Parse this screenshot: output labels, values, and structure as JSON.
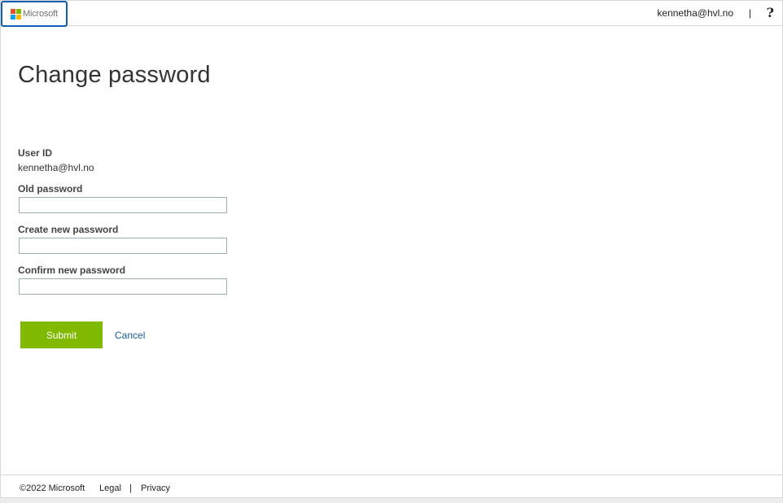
{
  "header": {
    "logo_text": "Microsoft",
    "user_email": "kennetha@hvl.no",
    "separator": "|",
    "help_glyph": "?"
  },
  "main": {
    "title": "Change password",
    "user_id_label": "User ID",
    "user_id_value": "kennetha@hvl.no",
    "old_password_label": "Old password",
    "old_password_value": "",
    "new_password_label": "Create new password",
    "new_password_value": "",
    "confirm_password_label": "Confirm new password",
    "confirm_password_value": "",
    "submit_label": "Submit",
    "cancel_label": "Cancel"
  },
  "footer": {
    "copyright": "©2022 Microsoft",
    "legal": "Legal",
    "separator": "|",
    "privacy": "Privacy"
  },
  "colors": {
    "accent_green": "#7fba00",
    "link_blue": "#1a5fa0",
    "logo_border": "#0f5fb4"
  },
  "icons": [
    "microsoft-logo-icon",
    "help-icon"
  ]
}
